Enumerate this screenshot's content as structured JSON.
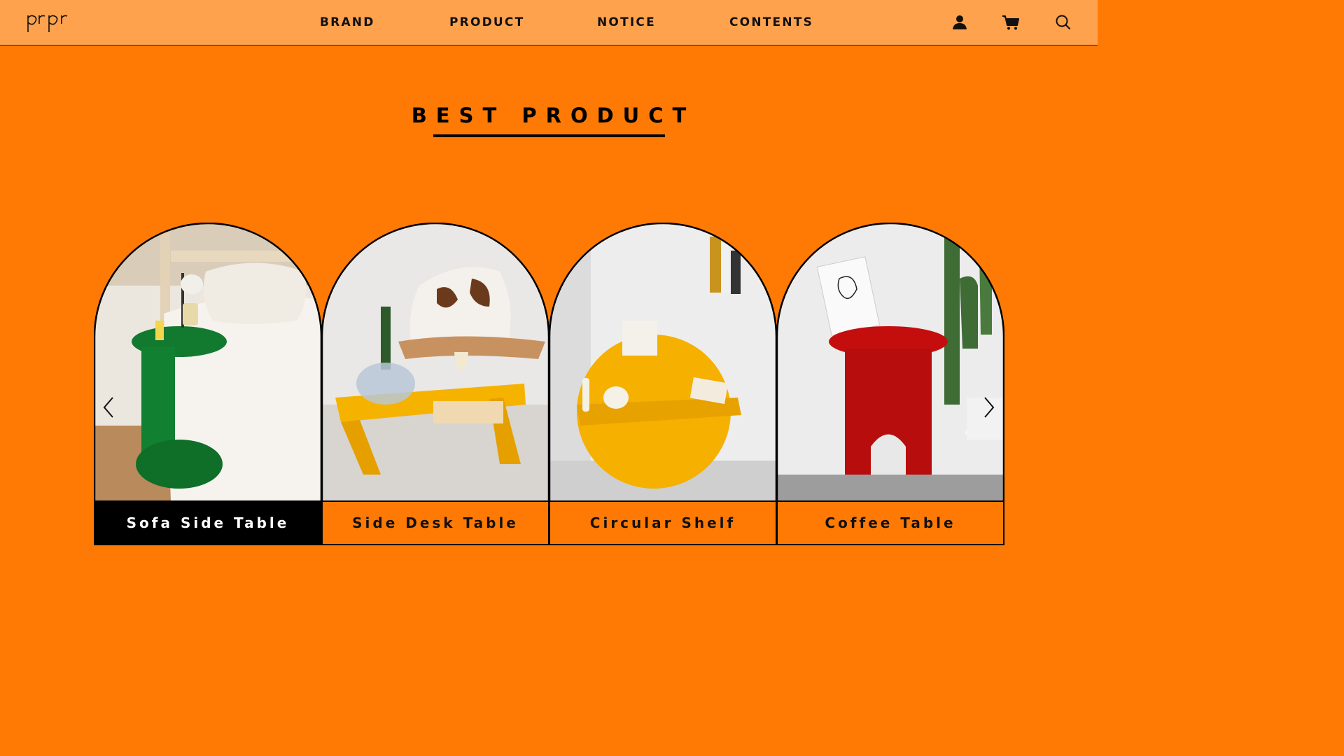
{
  "header": {
    "logo_text": "prpr",
    "nav": [
      "BRAND",
      "PRODUCT",
      "NOTICE",
      "CONTENTS"
    ],
    "icons": [
      "user-icon",
      "cart-icon",
      "search-icon"
    ]
  },
  "section": {
    "title": "BEST PRODUCT"
  },
  "products": [
    {
      "name": "Sofa Side Table",
      "active": true,
      "color": "#127a2e"
    },
    {
      "name": "Side Desk Table",
      "active": false,
      "color": "#f2a600"
    },
    {
      "name": "Circular Shelf",
      "active": false,
      "color": "#f5b000"
    },
    {
      "name": "Coffee Table",
      "active": false,
      "color": "#c80d0d"
    }
  ],
  "carousel": {
    "prev_icon": "chevron-left-icon",
    "next_icon": "chevron-right-icon"
  },
  "colors": {
    "background": "#ff7a05",
    "header": "#ffa24e"
  }
}
